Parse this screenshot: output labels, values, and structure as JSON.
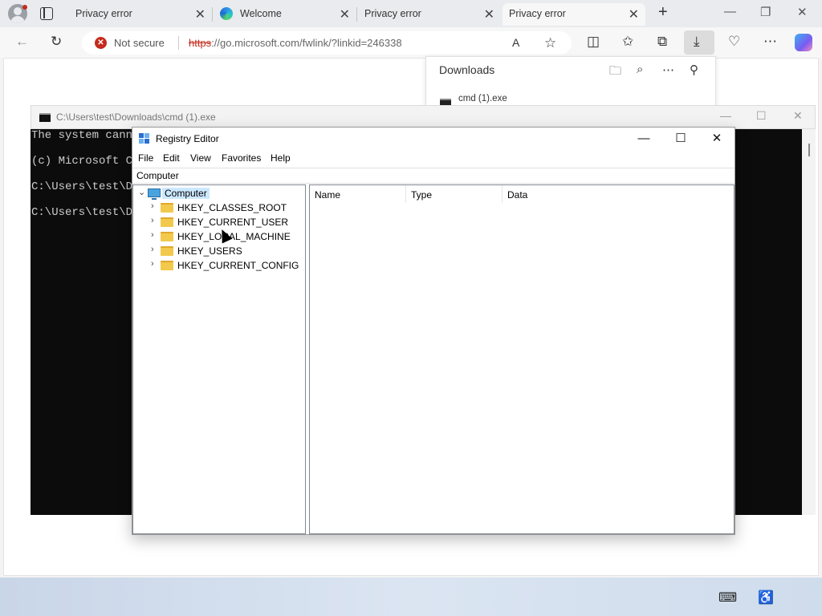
{
  "browser": {
    "tabs": [
      {
        "title": "Privacy error",
        "active": false
      },
      {
        "title": "Welcome",
        "active": false
      },
      {
        "title": "Privacy error",
        "active": false
      },
      {
        "title": "Privacy error",
        "active": true
      }
    ],
    "new_tab_glyph": "+",
    "close_glyph": "✕",
    "address": {
      "security_label": "Not secure",
      "url_scheme": "https",
      "url_rest": "://go.microsoft.com/fwlink/?linkid=246338"
    },
    "window_controls": {
      "minimize": "—",
      "restore": "❐",
      "close": "✕"
    },
    "icons": {
      "back": "back-arrow-icon",
      "refresh": "refresh-icon",
      "read_aloud": "read-aloud-icon",
      "favorite": "star-icon",
      "split": "split-screen-icon",
      "favorites": "favorites-icon",
      "collections": "collections-icon",
      "downloads": "download-icon",
      "health": "browser-essentials-icon",
      "more": "more-icon",
      "copilot": "copilot-icon"
    }
  },
  "downloads_panel": {
    "title": "Downloads",
    "file_name": "cmd (1).exe"
  },
  "cmd_window": {
    "title": "C:\\Users\\test\\Downloads\\cmd (1).exe",
    "lines": [
      "The system canno",
      "(c) Microsoft Co",
      "C:\\Users\\test\\Do",
      "C:\\Users\\test\\Do"
    ],
    "controls": {
      "minimize": "—",
      "maximize": "☐",
      "close": "✕"
    }
  },
  "regedit": {
    "title": "Registry Editor",
    "menu": [
      "File",
      "Edit",
      "View",
      "Favorites",
      "Help"
    ],
    "address": "Computer",
    "tree": {
      "root": "Computer",
      "children": [
        "HKEY_CLASSES_ROOT",
        "HKEY_CURRENT_USER",
        "HKEY_LOCAL_MACHINE",
        "HKEY_USERS",
        "HKEY_CURRENT_CONFIG"
      ]
    },
    "columns": [
      "Name",
      "Type",
      "Data"
    ],
    "controls": {
      "minimize": "—",
      "maximize": "☐",
      "close": "✕"
    }
  },
  "taskbar": {
    "icons": [
      "keyboard-icon",
      "accessibility-icon"
    ]
  }
}
